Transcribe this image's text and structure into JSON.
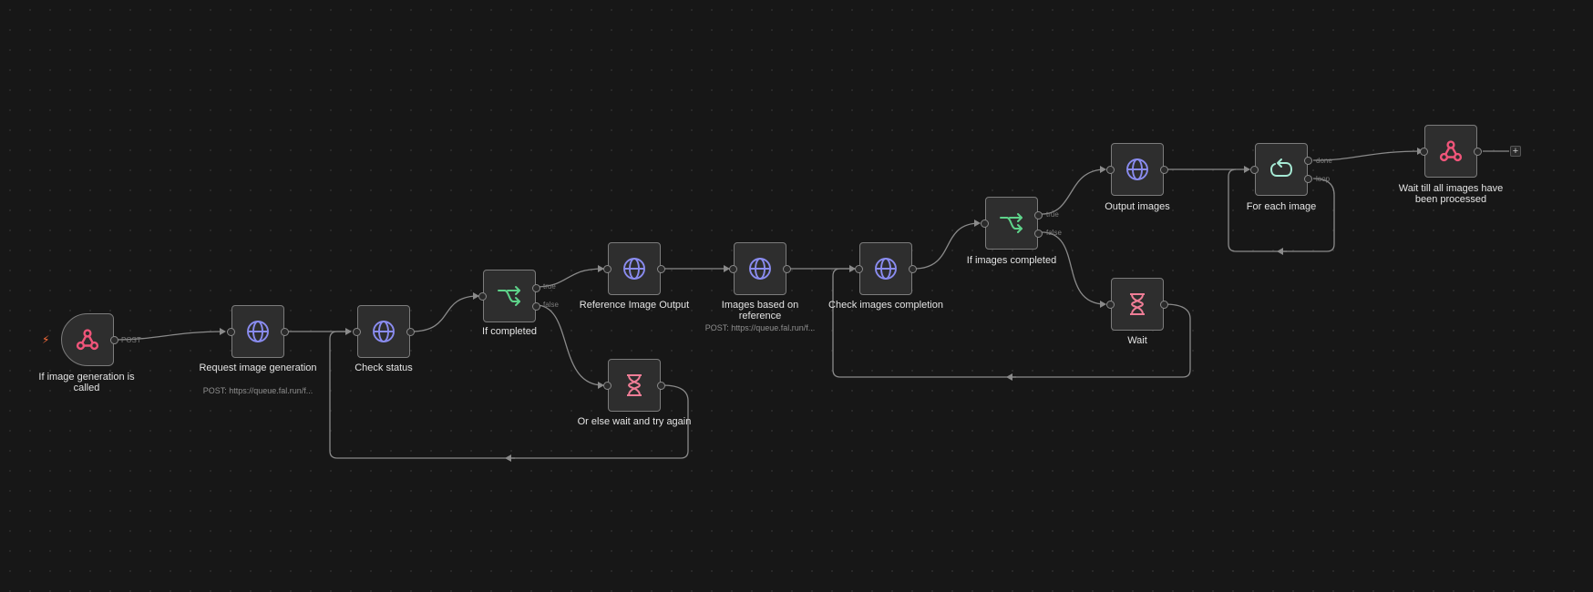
{
  "colors": {
    "canvas": "#171717",
    "node_bg": "#2e2e2e",
    "node_border": "#7c7c7c",
    "edge": "#8a8a8a",
    "webhook": "#f0557a",
    "http": "#8a8cf0",
    "branch": "#5ed38a",
    "wait": "#ef7d96",
    "loop": "#a6ead5",
    "trigger_bolt": "#ff6d3a"
  },
  "nodes": {
    "trigger": {
      "label": "If image generation is called",
      "icon": "webhook-icon",
      "handle_label": "POST",
      "bolt": "⚡"
    },
    "request": {
      "label": "Request image generation",
      "subtitle": "POST: https://queue.fal.run/f...",
      "icon": "globe-icon"
    },
    "check_status": {
      "label": "Check status",
      "icon": "globe-icon"
    },
    "if_completed": {
      "label": "If completed",
      "icon": "branch-icon",
      "true_label": "true",
      "false_label": "false"
    },
    "wait_retry": {
      "label": "Or else wait and try again",
      "icon": "hourglass-icon"
    },
    "ref_output": {
      "label": "Reference Image Output",
      "icon": "globe-icon"
    },
    "images_ref": {
      "label": "Images based on reference",
      "subtitle": "POST: https://queue.fal.run/f...",
      "icon": "globe-icon"
    },
    "check_images": {
      "label": "Check images completion",
      "icon": "globe-icon"
    },
    "if_images": {
      "label": "If images completed",
      "icon": "branch-icon",
      "true_label": "true",
      "false_label": "false"
    },
    "output_images": {
      "label": "Output images",
      "icon": "globe-icon"
    },
    "wait": {
      "label": "Wait",
      "icon": "hourglass-icon"
    },
    "for_each": {
      "label": "For each image",
      "icon": "loop-icon",
      "done_label": "done",
      "loop_label": "loop"
    },
    "wait_all": {
      "label": "Wait till all images have been processed",
      "icon": "webhook-icon",
      "add_label": "+"
    }
  }
}
